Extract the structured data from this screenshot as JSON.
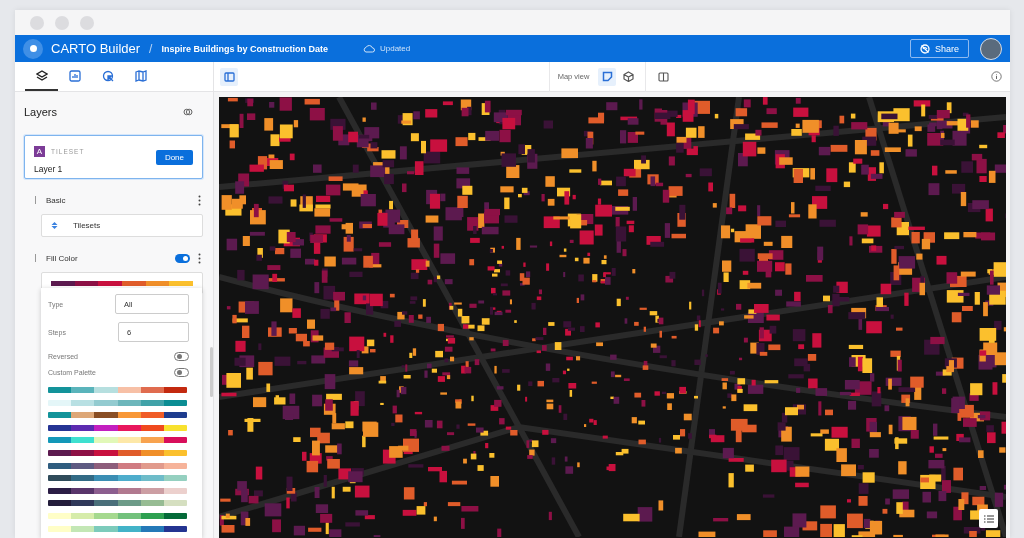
{
  "header": {
    "logo": "CARTO Builder",
    "separator": "/",
    "map_title": "Inspire Buildings by Construction Date",
    "save_status": "Updated",
    "share_label": "Share"
  },
  "sidebar_tabs": [
    {
      "kind": "layers",
      "selected": true
    },
    {
      "kind": "chart",
      "selected": false
    },
    {
      "kind": "pointer",
      "selected": false
    },
    {
      "kind": "map",
      "selected": false
    }
  ],
  "toolbar": {
    "panel_toggle_on": true,
    "view_label": "Map view",
    "views": [
      {
        "kind": "flat",
        "selected": true
      },
      {
        "kind": "globe",
        "selected": false
      }
    ]
  },
  "layers_panel": {
    "title": "Layers",
    "layer": {
      "badge": "A",
      "type_label": "TILESET",
      "name": "Layer 1",
      "done_label": "Done"
    },
    "basic": {
      "title": "Basic",
      "source": "Tilesets"
    },
    "fill_color": {
      "title": "Fill Color",
      "on": true,
      "palette": [
        {
          "color": "#5c1a4f"
        },
        {
          "color": "#8d1045"
        },
        {
          "color": "#c8103e"
        },
        {
          "color": "#e05c2a"
        },
        {
          "color": "#f08f29"
        },
        {
          "color": "#fbc02d"
        }
      ]
    },
    "type": {
      "label": "Type",
      "value": "All"
    },
    "steps": {
      "label": "Steps",
      "value": "6"
    },
    "toggles": [
      {
        "label": "Reversed",
        "on": false
      },
      {
        "label": "Custom Palette",
        "on": false
      }
    ],
    "palettes": [
      {
        "swatches": [
          {
            "color": "#13939a"
          },
          {
            "color": "#5ab4bb"
          },
          {
            "color": "#b6dfdf"
          },
          {
            "color": "#f7c0a6"
          },
          {
            "color": "#e06c4f"
          },
          {
            "color": "#c3290f"
          }
        ]
      },
      {
        "swatches": [
          {
            "color": "#e4f6f8"
          },
          {
            "color": "#b8e0e3"
          },
          {
            "color": "#93cbd0"
          },
          {
            "color": "#6db6bb"
          },
          {
            "color": "#41a2a8"
          },
          {
            "color": "#0b8d93"
          }
        ]
      },
      {
        "swatches": [
          {
            "color": "#12939a"
          },
          {
            "color": "#dda777"
          },
          {
            "color": "#894e24"
          },
          {
            "color": "#f89736"
          },
          {
            "color": "#f05c27"
          },
          {
            "color": "#1e3c8e"
          }
        ]
      },
      {
        "swatches": [
          {
            "color": "#253494"
          },
          {
            "color": "#5c2bb0"
          },
          {
            "color": "#c31fbf"
          },
          {
            "color": "#e8175d"
          },
          {
            "color": "#f0491e"
          },
          {
            "color": "#f8e12e"
          }
        ]
      },
      {
        "swatches": [
          {
            "color": "#1398b8"
          },
          {
            "color": "#3ee0cf"
          },
          {
            "color": "#e1f8b8"
          },
          {
            "color": "#fde8a8"
          },
          {
            "color": "#f8a34f"
          },
          {
            "color": "#d80e5b"
          }
        ]
      },
      {
        "swatches": [
          {
            "color": "#5c1a4f"
          },
          {
            "color": "#8d1045"
          },
          {
            "color": "#c8103e"
          },
          {
            "color": "#e05c2a"
          },
          {
            "color": "#f08f29"
          },
          {
            "color": "#fbc02d"
          }
        ]
      },
      {
        "swatches": [
          {
            "color": "#2f5d7f"
          },
          {
            "color": "#5e5a82"
          },
          {
            "color": "#8d5d7b"
          },
          {
            "color": "#d07b82"
          },
          {
            "color": "#e19a8c"
          },
          {
            "color": "#f6b39a"
          }
        ]
      },
      {
        "swatches": [
          {
            "color": "#2f4b5a"
          },
          {
            "color": "#326a85"
          },
          {
            "color": "#3b8eb4"
          },
          {
            "color": "#4eadcc"
          },
          {
            "color": "#6ebcc9"
          },
          {
            "color": "#95d0c0"
          }
        ]
      },
      {
        "swatches": [
          {
            "color": "#2b1d45"
          },
          {
            "color": "#59356b"
          },
          {
            "color": "#8c5e8f"
          },
          {
            "color": "#b1798f"
          },
          {
            "color": "#cc9ea3"
          },
          {
            "color": "#ecd0cd"
          }
        ]
      },
      {
        "swatches": [
          {
            "color": "#231d3b"
          },
          {
            "color": "#30395a"
          },
          {
            "color": "#4a6f7a"
          },
          {
            "color": "#6d9b88"
          },
          {
            "color": "#97bc93"
          },
          {
            "color": "#d5dfc0"
          }
        ]
      },
      {
        "swatches": [
          {
            "color": "#fffec7"
          },
          {
            "color": "#d6ecaa"
          },
          {
            "color": "#a5d98f"
          },
          {
            "color": "#72c17c"
          },
          {
            "color": "#2da050"
          },
          {
            "color": "#046a38"
          }
        ]
      },
      {
        "swatches": [
          {
            "color": "#fffec7"
          },
          {
            "color": "#c3e7b5"
          },
          {
            "color": "#7ccbbb"
          },
          {
            "color": "#42b3c8"
          },
          {
            "color": "#2479b8"
          },
          {
            "color": "#243491"
          }
        ]
      }
    ]
  }
}
